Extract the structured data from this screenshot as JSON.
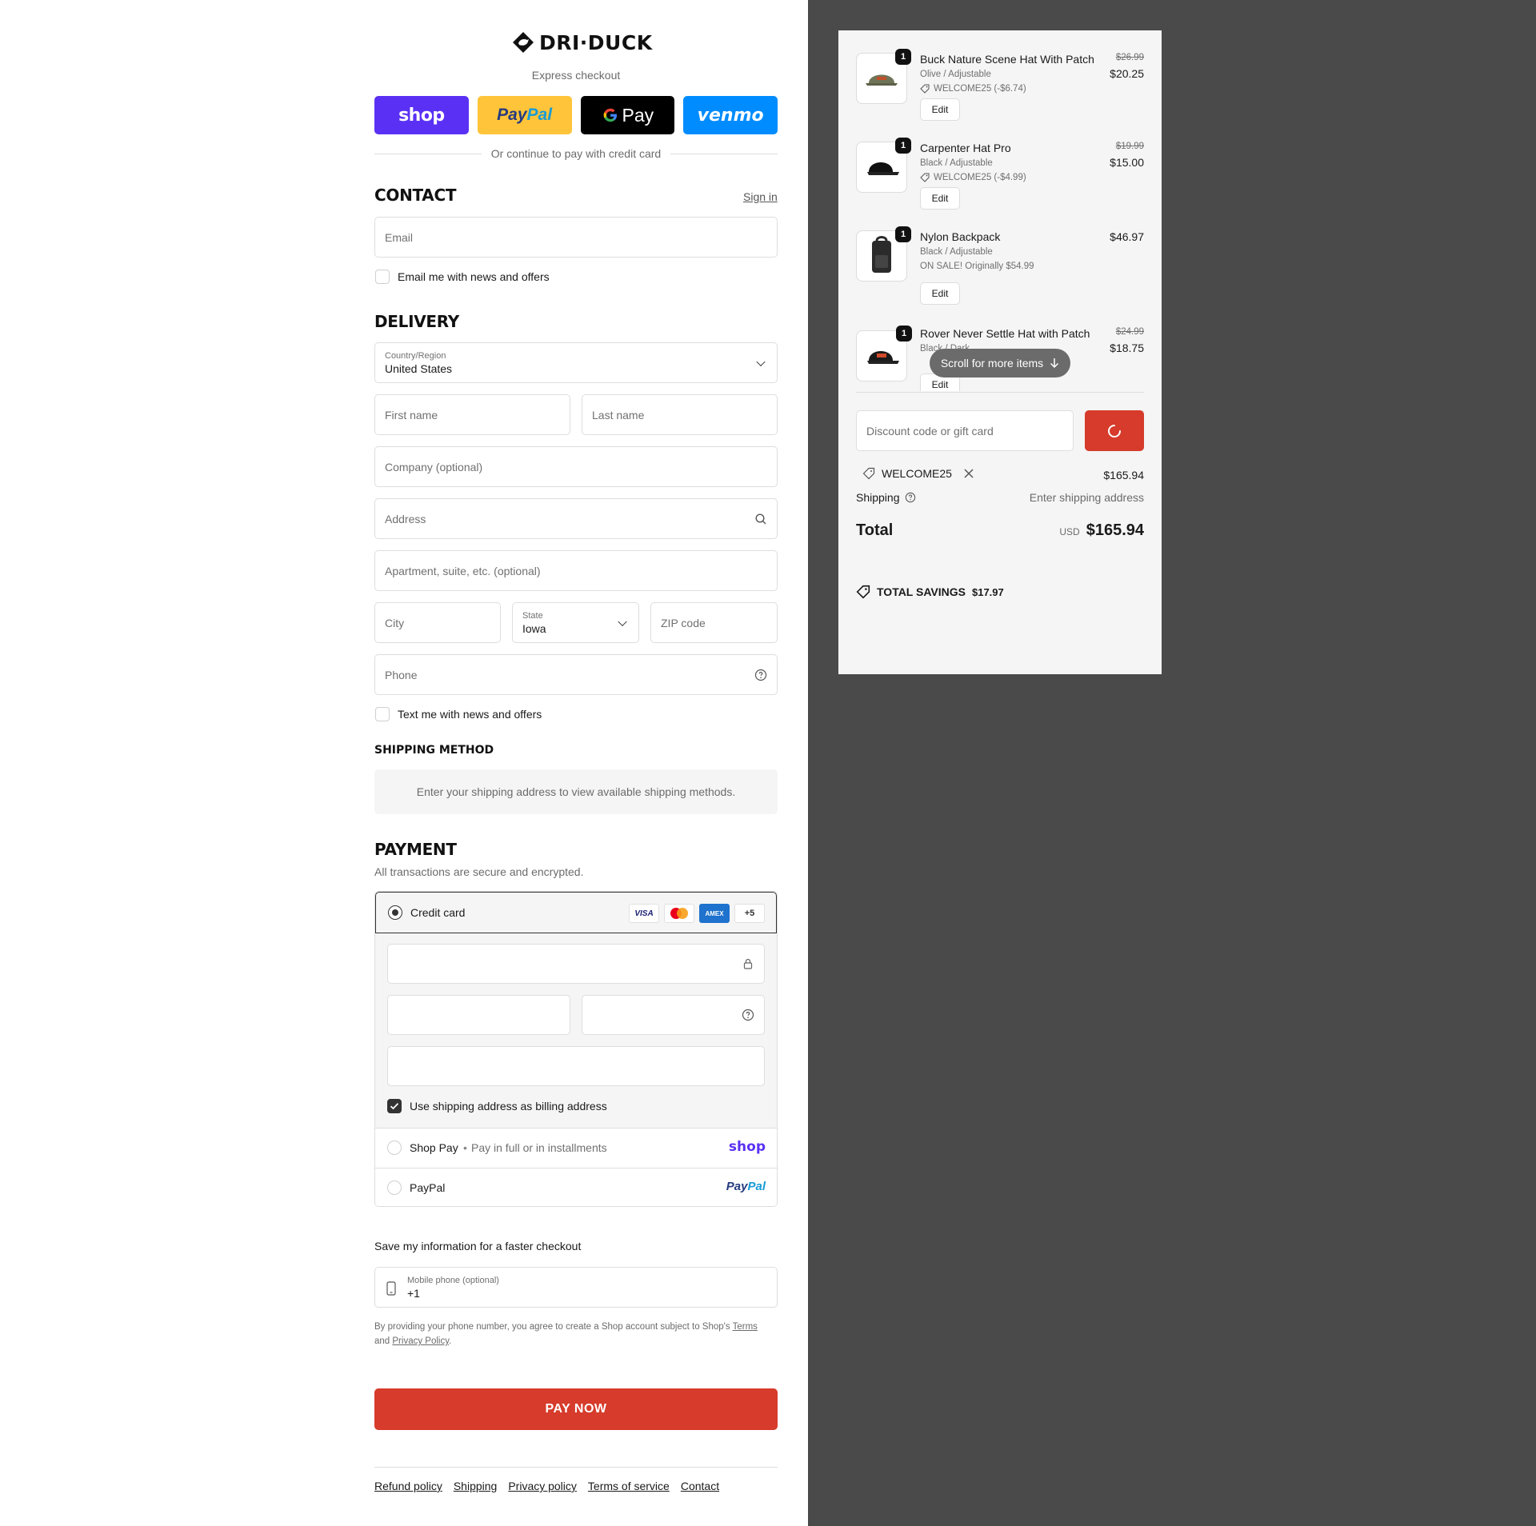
{
  "brand": {
    "name": "DRI·DUCK"
  },
  "express": {
    "label": "Express checkout",
    "buttons": {
      "shop": "shop",
      "paypal_1": "Pay",
      "paypal_2": "Pal",
      "gpay": "Pay",
      "venmo": "venmo"
    },
    "divider": "Or continue to pay with credit card"
  },
  "contact": {
    "title": "CONTACT",
    "sign_in": "Sign in",
    "email_placeholder": "Email",
    "news_label": "Email me with news and offers"
  },
  "delivery": {
    "title": "DELIVERY",
    "country_label": "Country/Region",
    "country_value": "United States",
    "first_name": "First name",
    "last_name": "Last name",
    "company": "Company (optional)",
    "address": "Address",
    "apartment": "Apartment, suite, etc. (optional)",
    "city": "City",
    "state_label": "State",
    "state_value": "Iowa",
    "zip": "ZIP code",
    "phone": "Phone",
    "text_label": "Text me with news and offers"
  },
  "shipping_method": {
    "title": "SHIPPING METHOD",
    "info": "Enter your shipping address to view available shipping methods."
  },
  "payment": {
    "title": "PAYMENT",
    "subtitle": "All transactions are secure and encrypted.",
    "credit_card": "Credit card",
    "card_logos": [
      "VISA",
      "MC",
      "AMEX",
      "+5"
    ],
    "billing_label": "Use shipping address as billing address",
    "shop_pay": "Shop Pay",
    "shop_pay_sub": "Pay in full or in installments",
    "shop_pay_logo": "shop",
    "paypal": "PayPal",
    "paypal_logo_1": "Pay",
    "paypal_logo_2": "Pal"
  },
  "save_info": {
    "title": "Save my information for a faster checkout",
    "mobile_label": "Mobile phone (optional)",
    "mobile_value": "+1",
    "legal_1": "By providing your phone number, you agree to create a Shop account subject to Shop's",
    "terms": "Terms",
    "legal_and": "and",
    "privacy": "Privacy Policy",
    "legal_end": "."
  },
  "pay_now": "PAY NOW",
  "footer": [
    "Refund policy",
    "Shipping",
    "Privacy policy",
    "Terms of service",
    "Contact"
  ],
  "cart": {
    "items": [
      {
        "qty": "1",
        "name": "Buck Nature Scene Hat With Patch",
        "variant": "Olive / Adjustable",
        "note": "WELCOME25 (-$6.74)",
        "old_price": "$26.99",
        "price": "$20.25",
        "edit": "Edit"
      },
      {
        "qty": "1",
        "name": "Carpenter Hat Pro",
        "variant": "Black / Adjustable",
        "note": "WELCOME25 (-$4.99)",
        "old_price": "$19.99",
        "price": "$15.00",
        "edit": "Edit"
      },
      {
        "qty": "1",
        "name": "Nylon Backpack",
        "variant": "Black / Adjustable",
        "note": "ON SALE! Originally $54.99",
        "old_price": "",
        "price": "$46.97",
        "edit": "Edit"
      },
      {
        "qty": "1",
        "name": "Rover Never Settle Hat with Patch",
        "variant": "Black / Dark",
        "note": "",
        "old_price": "$24.99",
        "price": "$18.75",
        "edit": "Edit"
      }
    ],
    "scroll_pill": "Scroll for more items",
    "discount_placeholder": "Discount code or gift card",
    "applied_code": "WELCOME25",
    "subtotal": "$165.94",
    "shipping_label": "Shipping",
    "shipping_value": "Enter shipping address",
    "total_label": "Total",
    "currency": "USD",
    "total_value": "$165.94",
    "savings_label": "TOTAL SAVINGS",
    "savings_value": "$17.97"
  },
  "colors": {
    "accent": "#d63b2b",
    "shop": "#5a31f4",
    "paypal": "#ffc439",
    "venmo": "#008cff",
    "panel": "#f5f5f5",
    "backdrop": "#4a4a4a"
  }
}
